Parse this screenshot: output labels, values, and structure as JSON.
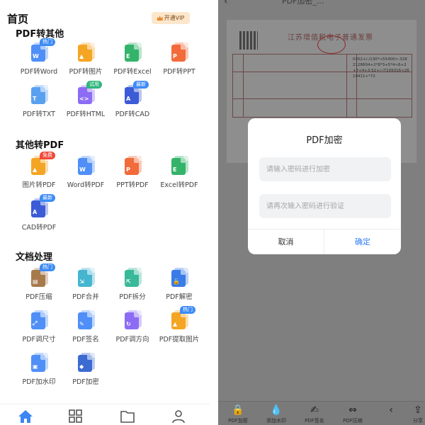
{
  "header": {
    "title": "首页",
    "vip_label": "开通VIP"
  },
  "sections": [
    {
      "title": "PDF转其他",
      "tools": [
        {
          "label": "PDF转Word",
          "badge": "热门"
        },
        {
          "label": "PDF转图片"
        },
        {
          "label": "PDF转Excel"
        },
        {
          "label": "PDF转PPT"
        },
        {
          "label": "PDF转TXT"
        },
        {
          "label": "PDF转HTML",
          "badge": "试用"
        },
        {
          "label": "PDF转CAD",
          "badge": "最新"
        }
      ]
    },
    {
      "title": "其他转PDF",
      "tools": [
        {
          "label": "图片转PDF",
          "badge": "免费"
        },
        {
          "label": "Word转PDF"
        },
        {
          "label": "PPT转PDF"
        },
        {
          "label": "Excel转PDF"
        },
        {
          "label": "CAD转PDF",
          "badge": "最新"
        }
      ]
    },
    {
      "title": "文档处理",
      "tools": [
        {
          "label": "PDF压缩",
          "badge": "热门"
        },
        {
          "label": "PDF合并"
        },
        {
          "label": "PDF拆分"
        },
        {
          "label": "PDF解密"
        },
        {
          "label": "PDF调尺寸"
        },
        {
          "label": "PDF签名"
        },
        {
          "label": "PDF调方向"
        },
        {
          "label": "PDF提取图片",
          "badge": "热门"
        },
        {
          "label": "PDF加水印"
        },
        {
          "label": "PDF加密"
        }
      ]
    }
  ],
  "bottom_nav": [
    {
      "icon": "home-icon"
    },
    {
      "icon": "grid-icon"
    },
    {
      "icon": "folder-icon"
    },
    {
      "icon": "user-icon"
    }
  ],
  "viewer": {
    "title": "PDF加密_...",
    "invoice_title": "江苏增值税电子普通发票",
    "invoice_code": "0352+/-/130*<55400>-3282128604+2*8*3+5*4<6+2+7<4+3-52+/-/7105016<2619411+*72",
    "toolbar": [
      {
        "label": "PDF加密",
        "icon": "lock-icon"
      },
      {
        "label": "添加水印",
        "icon": "drop-icon"
      },
      {
        "label": "PDF签名",
        "icon": "pen-icon"
      },
      {
        "label": "PDF压缩",
        "icon": "compress-icon"
      },
      {
        "label": "",
        "icon": "more-icon"
      },
      {
        "label": "分享",
        "icon": "share-icon"
      }
    ]
  },
  "dialog": {
    "title": "PDF加密",
    "password_placeholder": "请输入密码进行加密",
    "confirm_placeholder": "请再次输入密码进行验证",
    "cancel_label": "取消",
    "ok_label": "确定"
  },
  "colors": {
    "blue": "#4f8ff7",
    "orange": "#f5a524",
    "green": "#34b36a",
    "red": "#f26b3a",
    "purple": "#8c6cf4",
    "navy": "#3c5bd6",
    "accent": "#2f7df6"
  }
}
